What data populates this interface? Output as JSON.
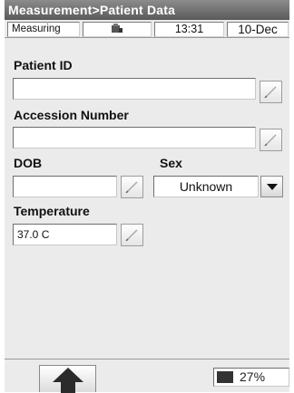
{
  "window": {
    "title": "Measurement>Patient Data"
  },
  "status": {
    "mode": "Measuring",
    "device_icon": "device-icon",
    "time": "13:31",
    "date": "10-Dec"
  },
  "form": {
    "patient_id": {
      "label": "Patient ID",
      "value": "",
      "edit_icon": "pencil-icon"
    },
    "accession_number": {
      "label": "Accession Number",
      "value": "",
      "edit_icon": "pencil-icon"
    },
    "dob": {
      "label": "DOB",
      "value": "",
      "edit_icon": "pencil-icon"
    },
    "sex": {
      "label": "Sex",
      "value": "Unknown",
      "dropdown_icon": "triangle-down-icon"
    },
    "temperature": {
      "label": "Temperature",
      "value": "37.0 C",
      "edit_icon": "pencil-icon"
    }
  },
  "footer": {
    "back_icon": "arrow-up-icon",
    "battery": {
      "text": "27%",
      "level_percent": 27
    }
  },
  "colors": {
    "titlebar": "#6e6e6e",
    "background": "#ebebeb"
  }
}
